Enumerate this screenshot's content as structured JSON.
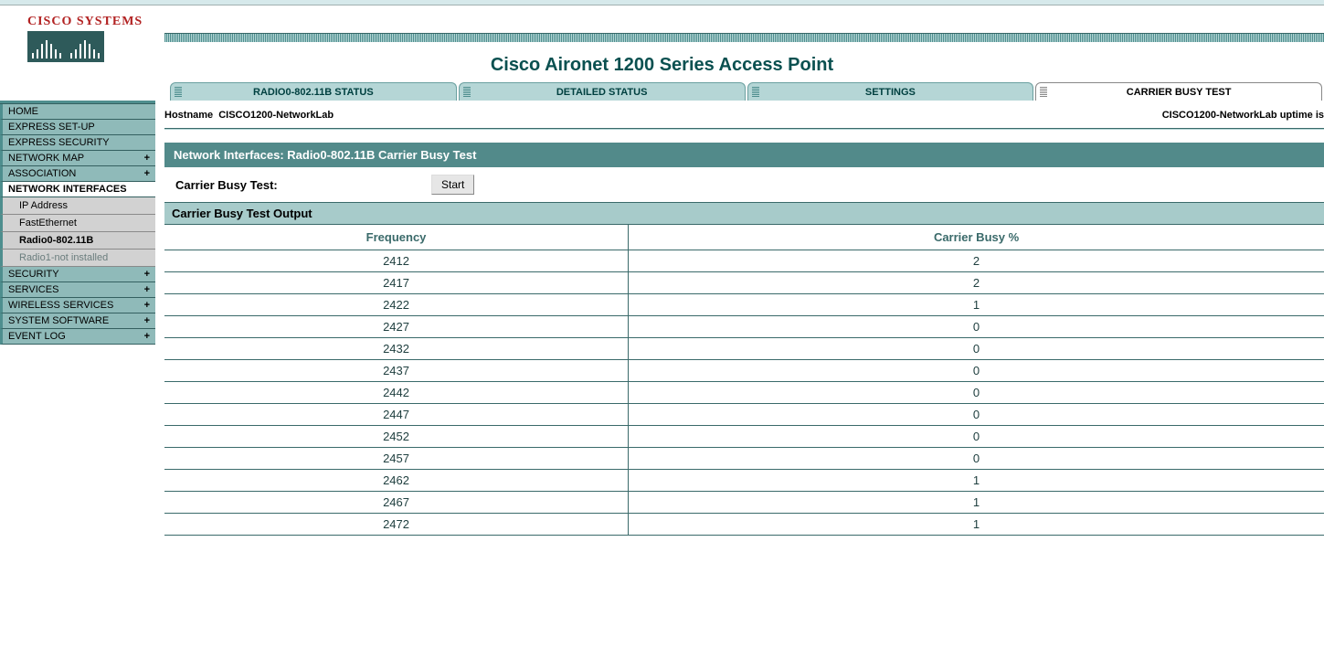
{
  "logo_text": "CISCO SYSTEMS",
  "page_title": "Cisco Aironet 1200 Series Access Point",
  "tabs": [
    {
      "label": "RADIO0-802.11B  STATUS",
      "active": false
    },
    {
      "label": "DETAILED STATUS",
      "active": false
    },
    {
      "label": "SETTINGS",
      "active": false
    },
    {
      "label": "CARRIER BUSY TEST",
      "active": true
    }
  ],
  "hostname_label": "Hostname",
  "hostname_value": "CISCO1200-NetworkLab",
  "uptime_text": "CISCO1200-NetworkLab uptime is",
  "section_header": "Network Interfaces: Radio0-802.11B Carrier Busy Test",
  "carrier_label": "Carrier Busy Test:",
  "start_button": "Start",
  "output_header": "Carrier Busy Test Output",
  "col_freq": "Frequency",
  "col_busy": "Carrier Busy %",
  "rows": [
    {
      "freq": "2412",
      "busy": "2"
    },
    {
      "freq": "2417",
      "busy": "2"
    },
    {
      "freq": "2422",
      "busy": "1"
    },
    {
      "freq": "2427",
      "busy": "0"
    },
    {
      "freq": "2432",
      "busy": "0"
    },
    {
      "freq": "2437",
      "busy": "0"
    },
    {
      "freq": "2442",
      "busy": "0"
    },
    {
      "freq": "2447",
      "busy": "0"
    },
    {
      "freq": "2452",
      "busy": "0"
    },
    {
      "freq": "2457",
      "busy": "0"
    },
    {
      "freq": "2462",
      "busy": "1"
    },
    {
      "freq": "2467",
      "busy": "1"
    },
    {
      "freq": "2472",
      "busy": "1"
    }
  ],
  "sidebar": {
    "items": [
      {
        "label": "HOME",
        "expand": false
      },
      {
        "label": "EXPRESS SET-UP",
        "expand": false
      },
      {
        "label": "EXPRESS SECURITY",
        "expand": false
      },
      {
        "label": "NETWORK MAP",
        "expand": true
      },
      {
        "label": "ASSOCIATION",
        "expand": true
      },
      {
        "label": "NETWORK INTERFACES",
        "expand": false,
        "active": true
      },
      {
        "label": "SECURITY",
        "expand": true
      },
      {
        "label": "SERVICES",
        "expand": true
      },
      {
        "label": "WIRELESS SERVICES",
        "expand": true
      },
      {
        "label": "SYSTEM SOFTWARE",
        "expand": true
      },
      {
        "label": "EVENT LOG",
        "expand": true
      }
    ],
    "subs": [
      {
        "label": "IP Address",
        "state": "normal"
      },
      {
        "label": "FastEthernet",
        "state": "normal"
      },
      {
        "label": "Radio0-802.11B",
        "state": "selected"
      },
      {
        "label": "Radio1-not installed",
        "state": "disabled"
      }
    ]
  }
}
